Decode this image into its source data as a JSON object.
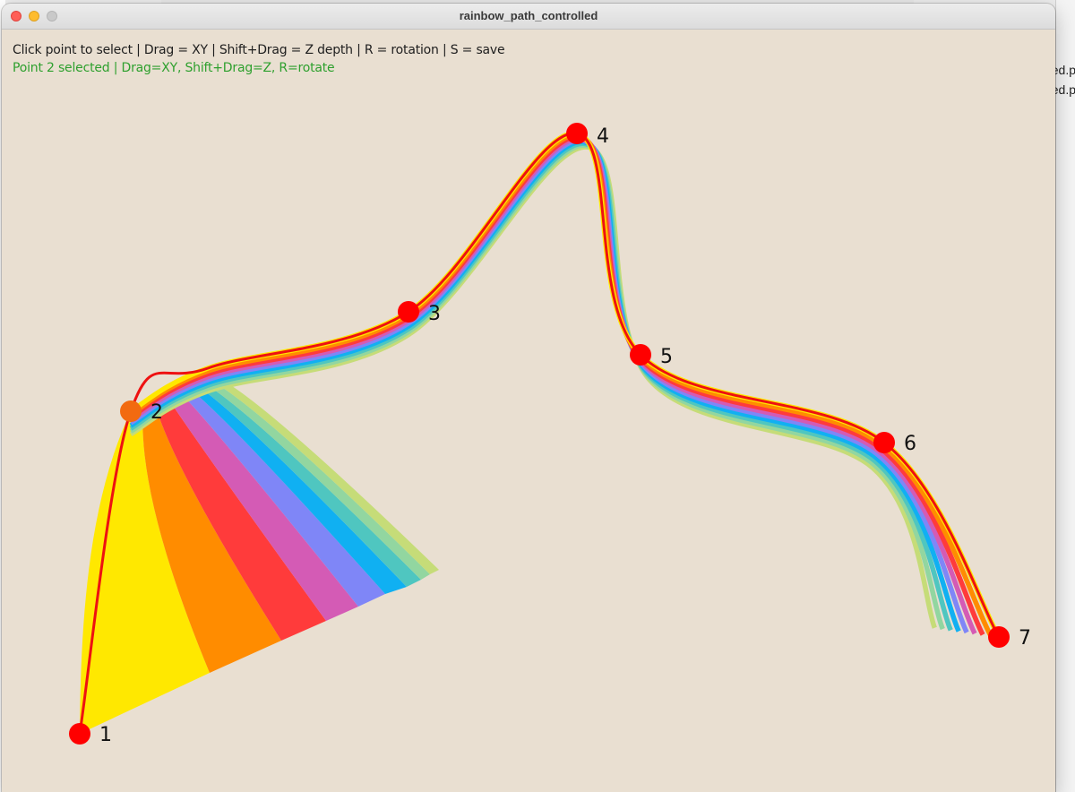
{
  "window": {
    "title": "rainbow_path_controlled"
  },
  "instructions": {
    "help": "Click point to select | Drag = XY | Shift+Drag = Z depth | R = rotation | S = save",
    "status": "Point 2 selected | Drag=XY, Shift+Drag=Z, R=rotate"
  },
  "points": [
    {
      "label": "1",
      "selected": false
    },
    {
      "label": "2",
      "selected": true
    },
    {
      "label": "3",
      "selected": false
    },
    {
      "label": "4",
      "selected": false
    },
    {
      "label": "5",
      "selected": false
    },
    {
      "label": "6",
      "selected": false
    },
    {
      "label": "7",
      "selected": false
    }
  ],
  "colors": {
    "canvas_bg": "#e9dfd1",
    "outline": "#ee1111",
    "point": "#ff0000",
    "point_selected": "#f26a10",
    "status_text": "#2ea02e",
    "bands": [
      "#ffe800",
      "#ff8c00",
      "#ff3b3b",
      "#d45bb5",
      "#7f86f7",
      "#10b0f2",
      "#4fc6c0",
      "#92d6a0",
      "#c6dc78"
    ]
  },
  "background_app": {
    "snippets": [
      "ed.p",
      "ed.p"
    ]
  }
}
